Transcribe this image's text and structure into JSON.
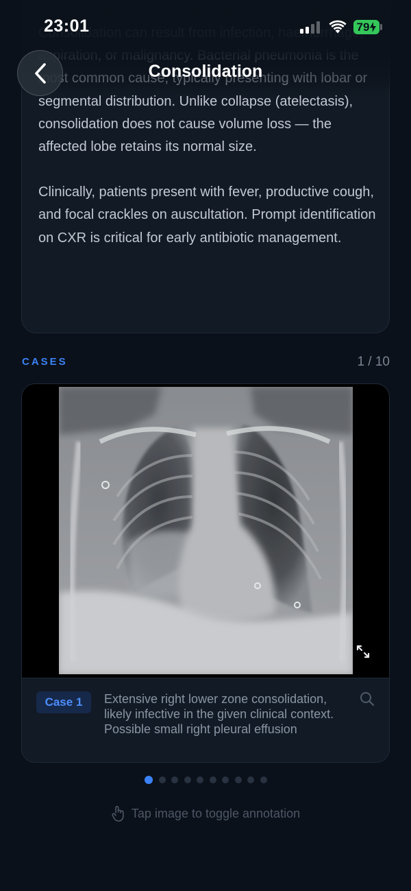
{
  "status_bar": {
    "time": "23:01",
    "battery": "79"
  },
  "nav": {
    "title": "Consolidation",
    "back_icon": "chevron-left-icon"
  },
  "description": {
    "paragraphs": [
      "Consolidation can result from infection, haemorrhage, aspiration, or malignancy. Bacterial pneumonia is the most common cause, typically presenting with lobar or segmental distribution. Unlike collapse (atelectasis), consolidation does not cause volume loss — the affected lobe retains its normal size.",
      "Clinically, patients present with fever, productive cough, and focal crackles on auscultation. Prompt identification on CXR is critical for early antibiotic management."
    ]
  },
  "cases": {
    "label": "CASES",
    "count": "1 / 10",
    "current": {
      "badge": "Case 1",
      "caption": "Extensive right lower zone consolidation, likely infective in the given clinical context. Possible small right pleural effusion",
      "image_desc": "Frontal chest radiograph"
    },
    "total_dots": 10,
    "active_dot": 0
  },
  "hint": "Tap image to toggle annotation",
  "colors": {
    "accent": "#3b82f6",
    "background": "#0b111a",
    "card": "#121a25",
    "battery": "#34c759"
  }
}
